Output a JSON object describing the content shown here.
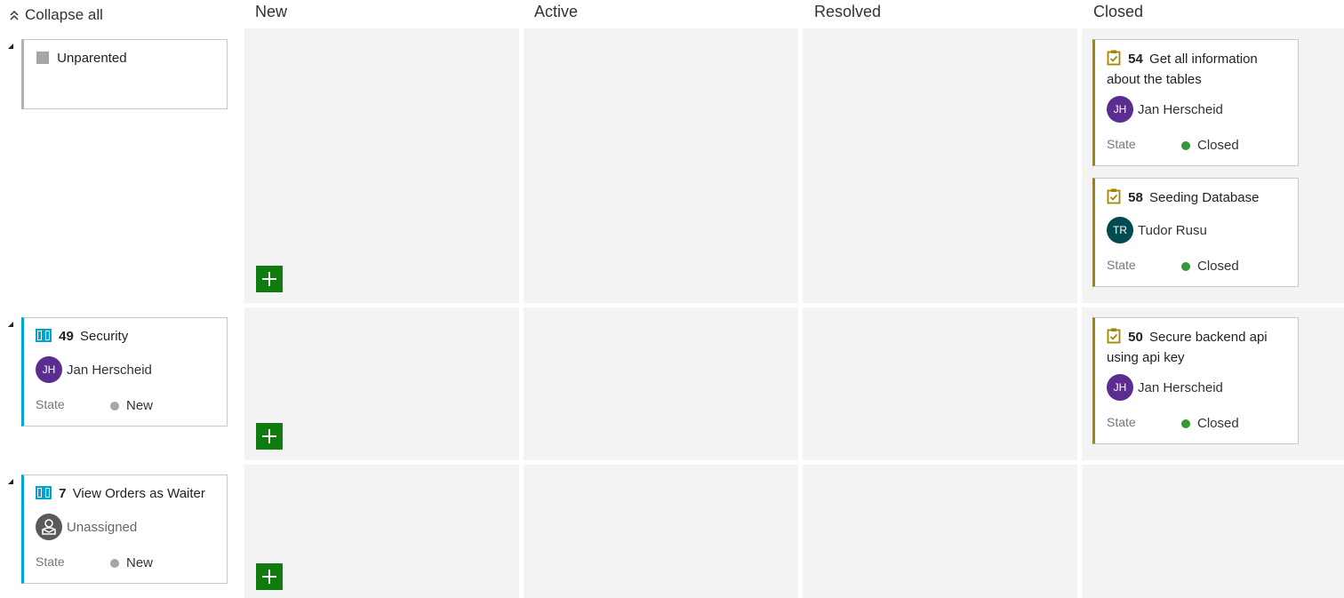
{
  "toolbar": {
    "collapse_all_label": "Collapse all"
  },
  "columns": [
    "New",
    "Active",
    "Resolved",
    "Closed"
  ],
  "colors": {
    "requirement_accent": "#00a3d1",
    "task_accent": "#a28600",
    "state_new": "#a6a6a6",
    "state_closed": "#339933",
    "add_button": "#107c10",
    "avatar_jh": "#5c2d91",
    "avatar_tr": "#004b50"
  },
  "rows": [
    {
      "parent": {
        "title": "Unparented"
      },
      "closed_cards": [
        {
          "id": "54",
          "title": "Get all information about the tables",
          "assignee": "Jan Herscheid",
          "initials": "JH",
          "state_label": "State",
          "state": "Closed",
          "icon": "task-icon"
        },
        {
          "id": "58",
          "title": "Seeding Database",
          "assignee": "Tudor Rusu",
          "initials": "TR",
          "state_label": "State",
          "state": "Closed",
          "icon": "task-icon"
        }
      ]
    },
    {
      "parent": {
        "id": "49",
        "title": "Security",
        "assignee": "Jan Herscheid",
        "initials": "JH",
        "state_label": "State",
        "state": "New",
        "icon": "book-icon"
      },
      "closed_cards": [
        {
          "id": "50",
          "title": "Secure backend api using api key",
          "assignee": "Jan Herscheid",
          "initials": "JH",
          "state_label": "State",
          "state": "Closed",
          "icon": "task-icon"
        }
      ]
    },
    {
      "parent": {
        "id": "7",
        "title": "View Orders as Waiter",
        "assignee": "Unassigned",
        "state_label": "State",
        "state": "New",
        "icon": "book-icon"
      },
      "closed_cards": []
    }
  ]
}
